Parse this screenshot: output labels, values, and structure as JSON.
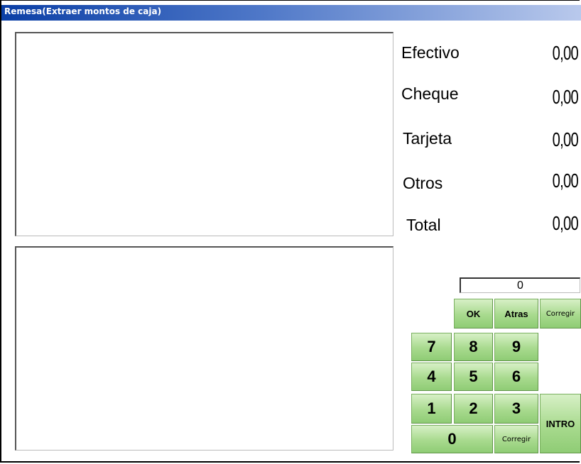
{
  "window": {
    "title": "Remesa(Extraer montos de caja)"
  },
  "totals": [
    {
      "label": "Efectivo",
      "value": "0,00"
    },
    {
      "label": "Cheque",
      "value": "0,00"
    },
    {
      "label": "Tarjeta",
      "value": "0,00"
    },
    {
      "label": "Otros",
      "value": "0,00"
    },
    {
      "label": "Total",
      "value": "0,00"
    }
  ],
  "keypad": {
    "display_value": "0",
    "ok": "OK",
    "atras": "Atras",
    "corregir_top": "Corregir",
    "corregir_bottom": "Corregir",
    "intro": "INTRO",
    "digits": {
      "0": "0",
      "1": "1",
      "2": "2",
      "3": "3",
      "4": "4",
      "5": "5",
      "6": "6",
      "7": "7",
      "8": "8",
      "9": "9"
    }
  }
}
